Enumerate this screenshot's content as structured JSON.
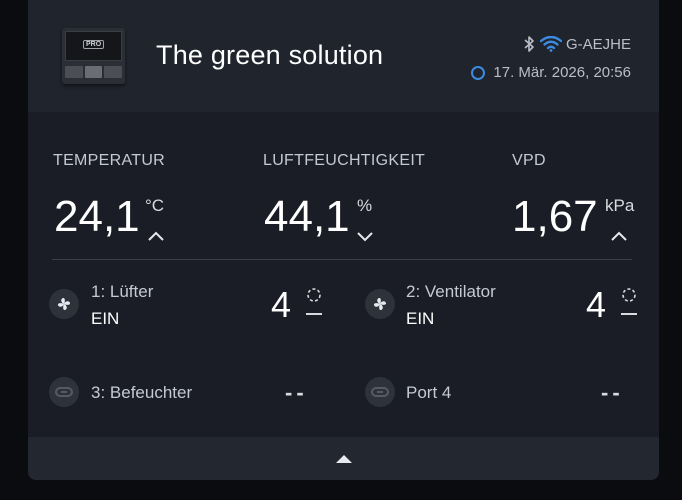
{
  "header": {
    "title": "The green solution",
    "device_badge": "PRO",
    "device_name": "G-AEJHE",
    "datetime": "17. Mär. 2026, 20:56",
    "icons": [
      "bluetooth-icon",
      "wifi-icon",
      "sync-status-icon"
    ]
  },
  "metrics": [
    {
      "label": "TEMPERATUR",
      "value": "24,1",
      "unit": "°C",
      "trend": "up"
    },
    {
      "label": "LUFTFEUCHTIGKEIT",
      "value": "44,1",
      "unit": "%",
      "trend": "down"
    },
    {
      "label": "VPD",
      "value": "1,67",
      "unit": "kPa",
      "trend": "up"
    }
  ],
  "ports": [
    {
      "name": "1: Lüfter",
      "state": "EIN",
      "level": "4",
      "icon": "fan-icon"
    },
    {
      "name": "2: Ventilator",
      "state": "EIN",
      "level": "4",
      "icon": "fan-icon"
    },
    {
      "name": "3: Befeuchter",
      "state": "",
      "level": "--",
      "icon": "plug-icon"
    },
    {
      "name": "Port 4",
      "state": "",
      "level": "--",
      "icon": "plug-icon"
    }
  ],
  "colors": {
    "background": "#0b0c10",
    "card": "#1a1d25",
    "header": "#20242d",
    "accent_wifi": "#3d8be0"
  }
}
